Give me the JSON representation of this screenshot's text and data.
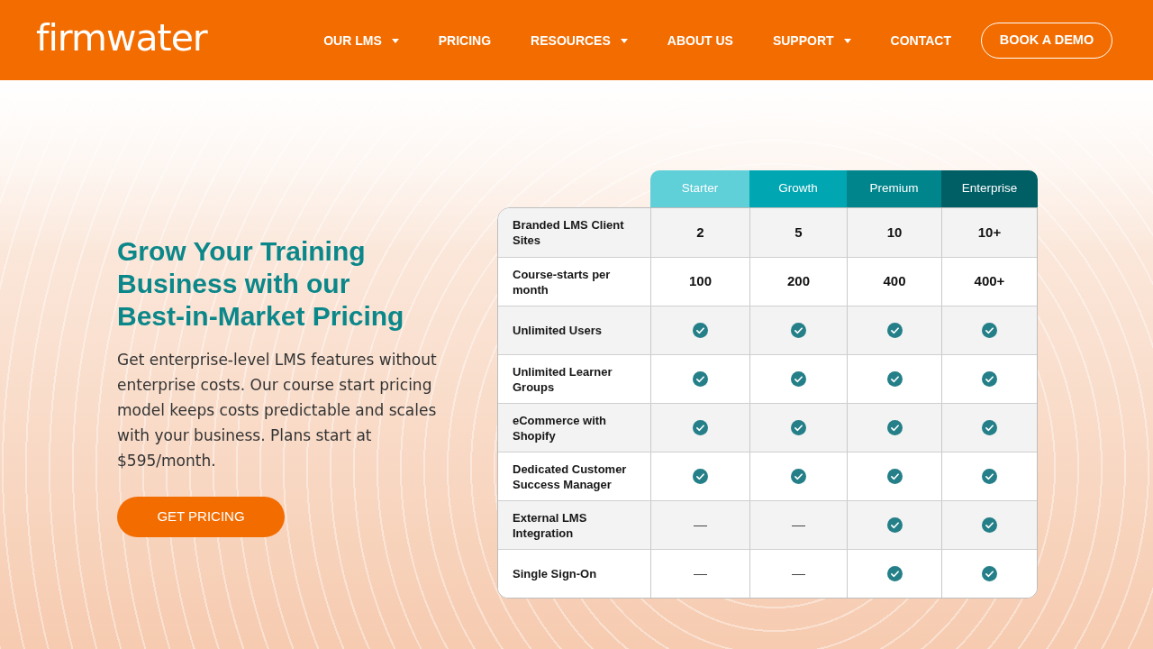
{
  "navbar": {
    "logo": "firmwater",
    "links": [
      {
        "label": "OUR LMS",
        "dropdown": true
      },
      {
        "label": "PRICING",
        "dropdown": false
      },
      {
        "label": "RESOURCES",
        "dropdown": true
      },
      {
        "label": "ABOUT US",
        "dropdown": false
      },
      {
        "label": "SUPPORT",
        "dropdown": true
      },
      {
        "label": "CONTACT",
        "dropdown": false
      }
    ],
    "cta": "BOOK A DEMO"
  },
  "hero": {
    "heading": "Grow Your Training Business with our Best-in-Market Pricing",
    "text": "Get enterprise-level LMS features without enterprise costs. Our course start pricing model keeps costs predictable and scales with your business. Plans start at $595/month.",
    "button": "GET PRICING"
  },
  "pricing_table": {
    "plans": [
      {
        "name": "Starter",
        "color": "#5fcfd8"
      },
      {
        "name": "Growth",
        "color": "#00a6b2"
      },
      {
        "name": "Premium",
        "color": "#00858c"
      },
      {
        "name": "Enterprise",
        "color": "#005e65"
      }
    ],
    "rows": [
      {
        "feature": "Branded LMS Client Sites",
        "cells": [
          {
            "kind": "text",
            "text": "2"
          },
          {
            "kind": "text",
            "text": "5"
          },
          {
            "kind": "text",
            "text": "10"
          },
          {
            "kind": "text",
            "text": "10+"
          }
        ]
      },
      {
        "feature": "Course-starts per month",
        "cells": [
          {
            "kind": "text",
            "text": "100"
          },
          {
            "kind": "text",
            "text": "200"
          },
          {
            "kind": "text",
            "text": "400"
          },
          {
            "kind": "text",
            "text": "400+"
          }
        ]
      },
      {
        "feature": "Unlimited Users",
        "cells": [
          {
            "kind": "check"
          },
          {
            "kind": "check"
          },
          {
            "kind": "check"
          },
          {
            "kind": "check"
          }
        ]
      },
      {
        "feature": "Unlimited Learner Groups",
        "cells": [
          {
            "kind": "check"
          },
          {
            "kind": "check"
          },
          {
            "kind": "check"
          },
          {
            "kind": "check"
          }
        ]
      },
      {
        "feature": "eCommerce with Shopify",
        "cells": [
          {
            "kind": "check"
          },
          {
            "kind": "check"
          },
          {
            "kind": "check"
          },
          {
            "kind": "check"
          }
        ]
      },
      {
        "feature": "Dedicated Customer Success Manager",
        "cells": [
          {
            "kind": "check"
          },
          {
            "kind": "check"
          },
          {
            "kind": "check"
          },
          {
            "kind": "check"
          }
        ]
      },
      {
        "feature": "External LMS Integration",
        "cells": [
          {
            "kind": "text",
            "text": "—"
          },
          {
            "kind": "text",
            "text": "—"
          },
          {
            "kind": "check"
          },
          {
            "kind": "check"
          }
        ]
      },
      {
        "feature": "Single Sign-On",
        "cells": [
          {
            "kind": "text",
            "text": "—"
          },
          {
            "kind": "text",
            "text": "—"
          },
          {
            "kind": "check"
          },
          {
            "kind": "check"
          }
        ]
      }
    ]
  }
}
